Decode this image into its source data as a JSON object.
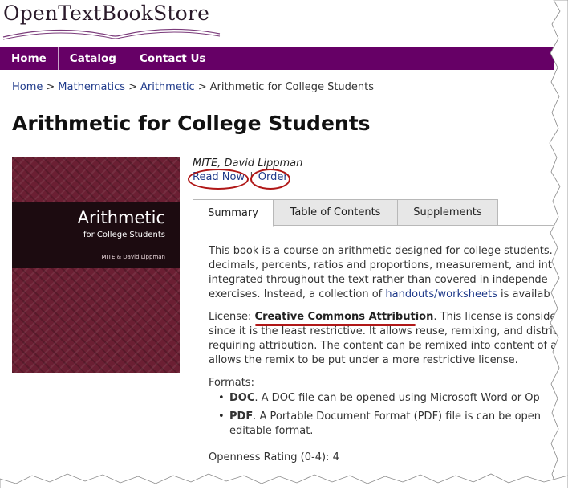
{
  "site": {
    "logo_text": "OpenTextBookStore"
  },
  "nav": {
    "items": [
      "Home",
      "Catalog",
      "Contact Us"
    ]
  },
  "breadcrumb": {
    "home": "Home",
    "sep": ">",
    "cat1": "Mathematics",
    "cat2": "Arithmetic",
    "current": "Arithmetic for College Students"
  },
  "page": {
    "title": "Arithmetic for College Students"
  },
  "cover": {
    "title": "Arithmetic",
    "subtitle": "for College Students",
    "author": "MITE & David Lippman"
  },
  "book": {
    "authors": "MITE, David Lippman",
    "read_now": "Read Now",
    "link_sep": "|",
    "order": "Order"
  },
  "tabs": [
    "Summary",
    "Table of Contents",
    "Supplements"
  ],
  "summary": {
    "lines": [
      "This book is a course on arithmetic designed for college students.",
      "decimals, percents, ratios and proportions, measurement, and int",
      "integrated throughout the text rather than covered in independe",
      "exercises. Instead, a collection of "
    ],
    "handouts_link": "handouts/worksheets",
    "line4_tail": " is availab",
    "license_label": "License: ",
    "license_value": "Creative Commons Attribution",
    "license_tail": ". This license is considered",
    "license_lines": [
      "since it is the least restrictive. It allows reuse, remixing, and distrib",
      "requiring attribution. The content can be remixed into content of a",
      "allows the remix to be put under a more restrictive license."
    ],
    "formats_label": "Formats:",
    "formats": [
      {
        "name": "DOC",
        "desc": ". A DOC file can be opened using Microsoft Word or Op"
      },
      {
        "name": "PDF",
        "desc": ". A Portable Document Format (PDF) file is can be open",
        "desc2": "editable format."
      }
    ],
    "rating_label": "Openness Rating (0-4): ",
    "rating_value": "4"
  },
  "colors": {
    "nav_bg": "#660066",
    "link": "#1f3a8a",
    "highlight": "#b01717",
    "cover_bg": "#6b1f33"
  }
}
